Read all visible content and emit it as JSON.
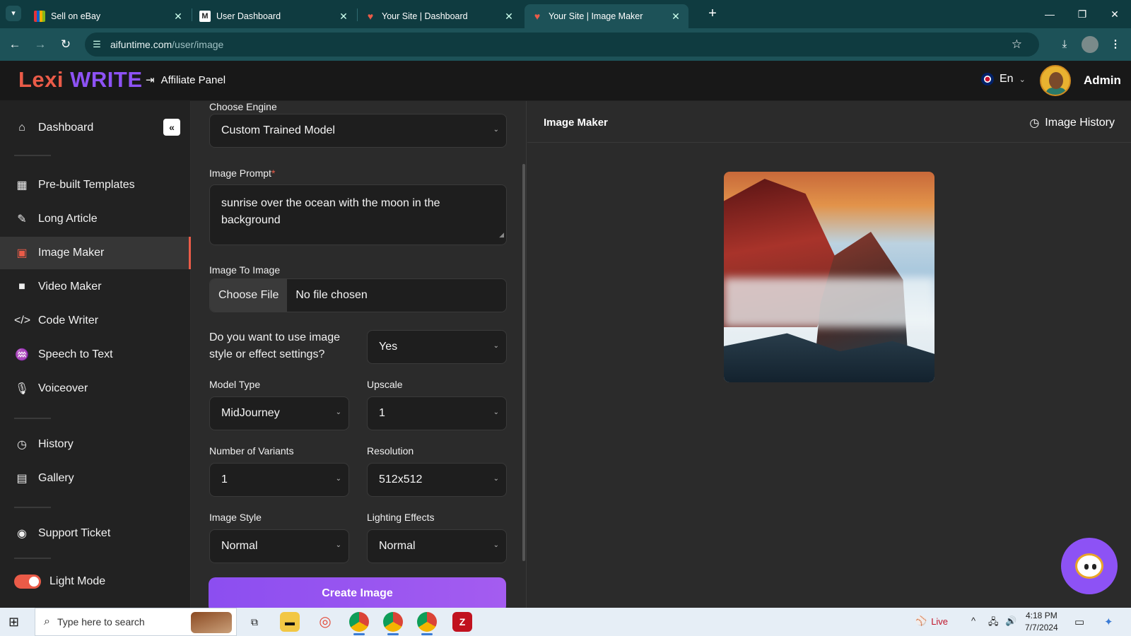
{
  "browser": {
    "tabs": [
      {
        "label": "Sell on eBay",
        "favicon": "ebay-icon"
      },
      {
        "label": "User Dashboard",
        "favicon": "m-icon"
      },
      {
        "label": "Your Site | Dashboard",
        "favicon": "site-icon"
      },
      {
        "label": "Your Site | Image Maker",
        "favicon": "site-icon",
        "active": true
      }
    ],
    "url_host": "aifuntime.com",
    "url_path": "/user/image"
  },
  "header": {
    "logo_part1": "Lexi",
    "logo_part2": "WRITE",
    "affiliate_label": "Affiliate Panel",
    "language": "En",
    "user_name": "Admin"
  },
  "sidebar": {
    "items": [
      {
        "label": "Dashboard",
        "icon": "home-icon"
      },
      {
        "label": "Pre-built Templates",
        "icon": "grid-icon"
      },
      {
        "label": "Long Article",
        "icon": "pen-icon"
      },
      {
        "label": "Image Maker",
        "icon": "image-icon",
        "active": true
      },
      {
        "label": "Video Maker",
        "icon": "video-icon"
      },
      {
        "label": "Code Writer",
        "icon": "code-icon"
      },
      {
        "label": "Speech to Text",
        "icon": "waveform-icon"
      },
      {
        "label": "Voiceover",
        "icon": "microphone-icon"
      },
      {
        "label": "History",
        "icon": "history-icon"
      },
      {
        "label": "Gallery",
        "icon": "gallery-icon"
      },
      {
        "label": "Support Ticket",
        "icon": "support-icon"
      }
    ],
    "light_mode_label": "Light Mode",
    "light_mode_on": true
  },
  "form": {
    "engine_label": "Choose Engine",
    "engine_value": "Custom Trained Model",
    "prompt_label": "Image Prompt",
    "prompt_required": "*",
    "prompt_value": "sunrise over the ocean with the moon in the background",
    "image_to_image_label": "Image To Image",
    "choose_file_label": "Choose File",
    "no_file_label": "No file chosen",
    "style_question": "Do you want to use image style or effect settings?",
    "style_answer": "Yes",
    "model_type_label": "Model Type",
    "model_type_value": "MidJourney",
    "upscale_label": "Upscale",
    "upscale_value": "1",
    "variants_label": "Number of Variants",
    "variants_value": "1",
    "resolution_label": "Resolution",
    "resolution_value": "512x512",
    "image_style_label": "Image Style",
    "image_style_value": "Normal",
    "lighting_label": "Lighting Effects",
    "lighting_value": "Normal",
    "create_button": "Create Image"
  },
  "result": {
    "title": "Image Maker",
    "history_label": "Image History"
  },
  "taskbar": {
    "search_placeholder": "Type here to search",
    "live_label": "Live",
    "time": "4:18 PM",
    "date": "7/7/2024"
  },
  "colors": {
    "brand_red": "#ea5b48",
    "brand_purple": "#8d52f5",
    "chrome_teal": "#1d5258"
  }
}
